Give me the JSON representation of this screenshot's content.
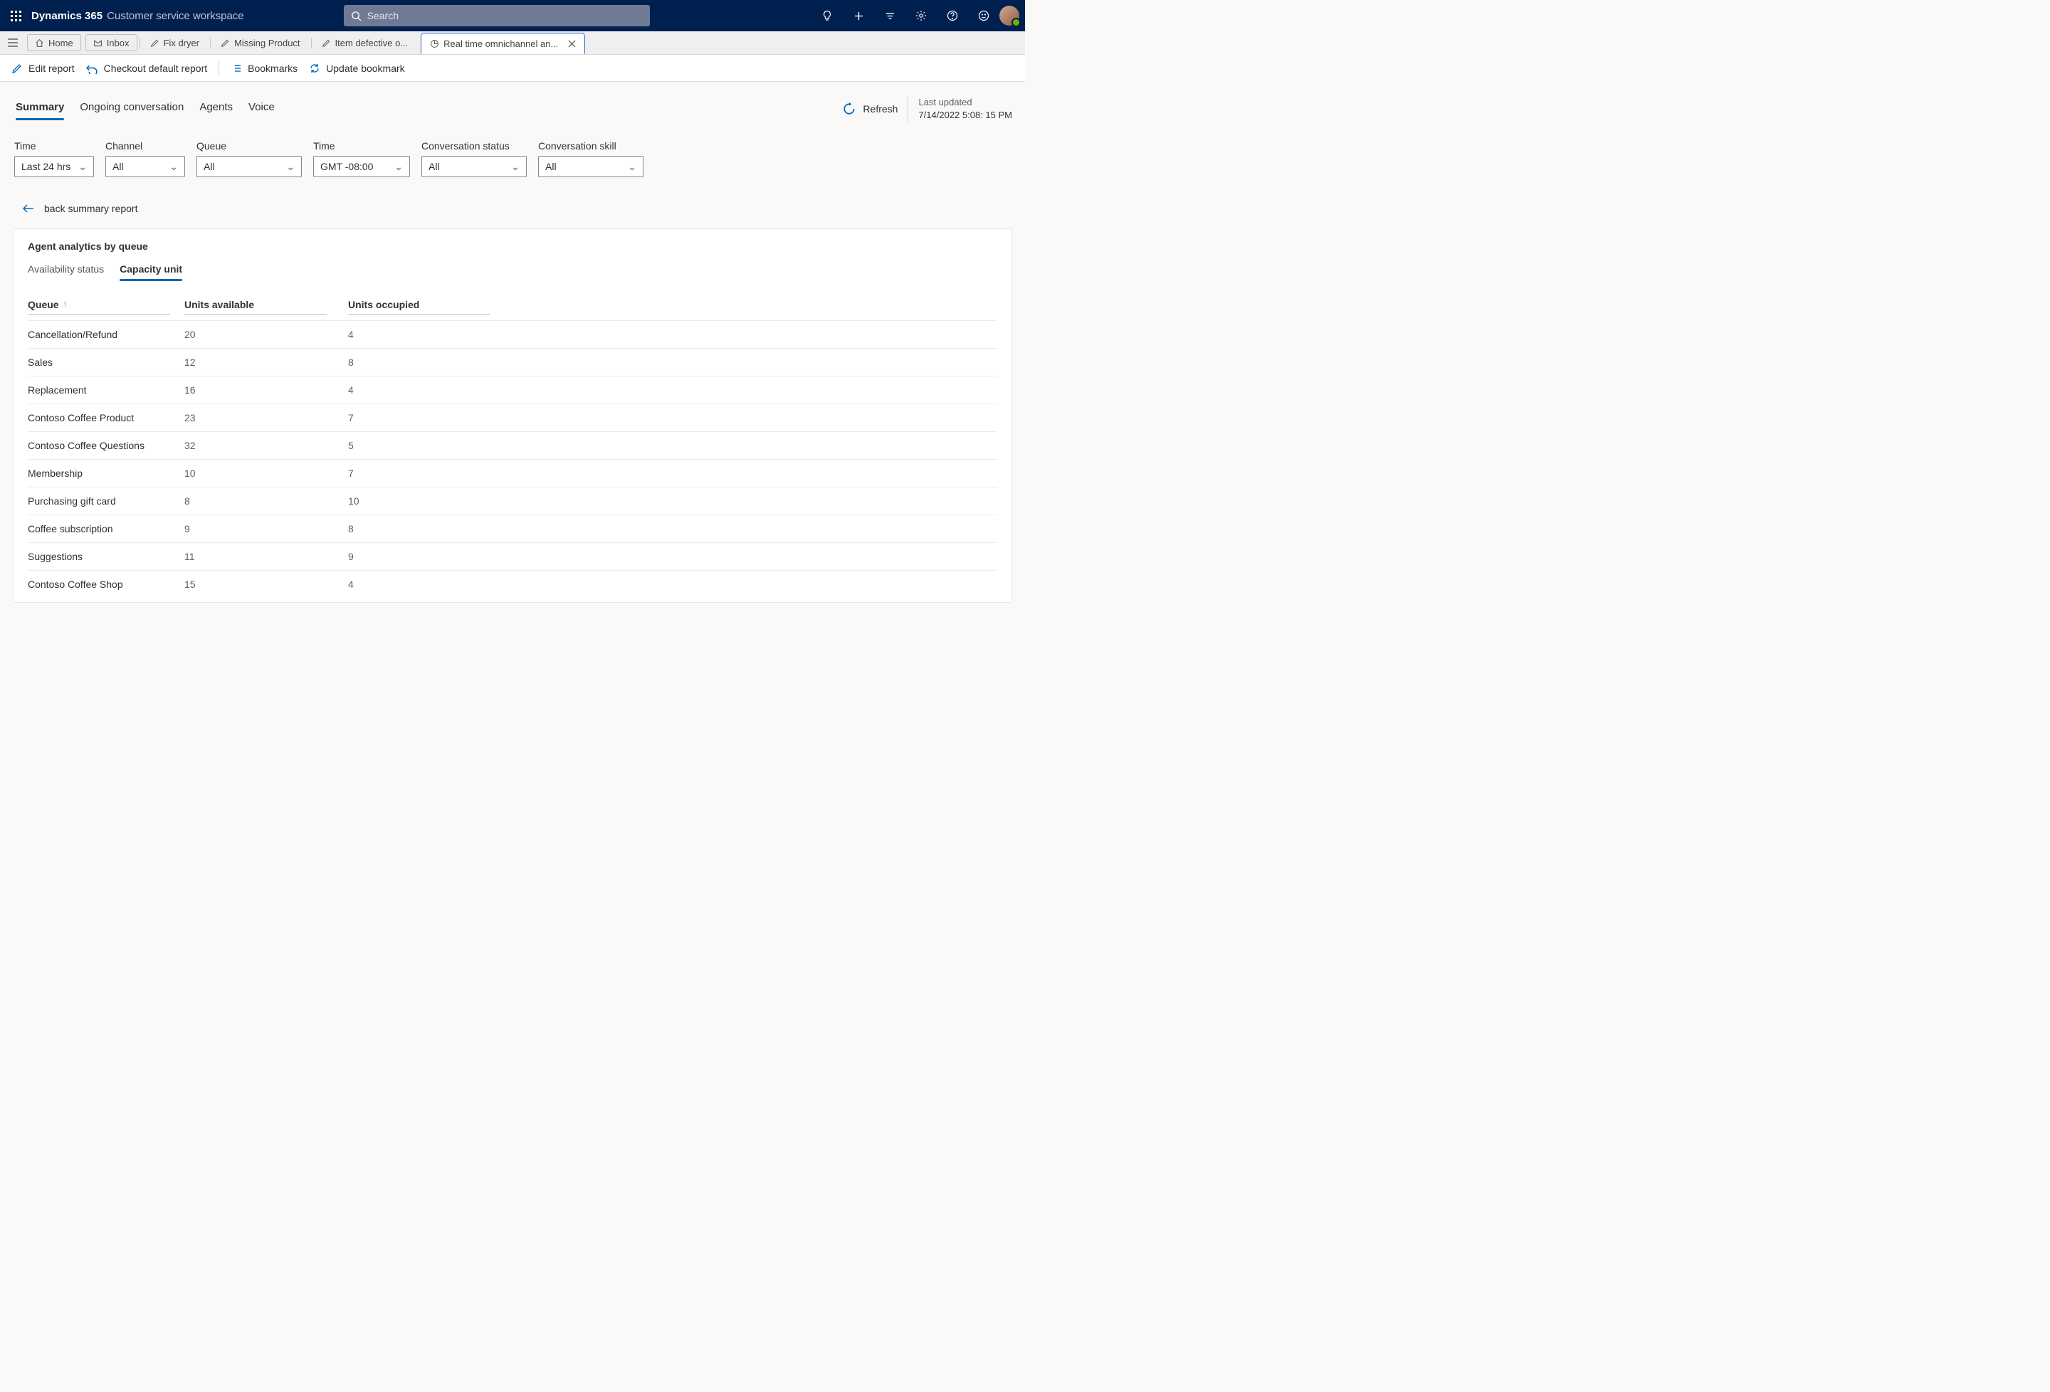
{
  "header": {
    "brand": "Dynamics 365",
    "workspace": "Customer service workspace",
    "search_placeholder": "Search"
  },
  "tabstrip": {
    "home": "Home",
    "inbox": "Inbox",
    "docs": [
      {
        "label": "Fix dryer"
      },
      {
        "label": "Missing Product"
      },
      {
        "label": "Item defective o..."
      },
      {
        "label": "Real time omnichannel an...",
        "active": true
      }
    ]
  },
  "commands": {
    "edit": "Edit report",
    "checkout": "Checkout default report",
    "bookmarks": "Bookmarks",
    "update": "Update bookmark"
  },
  "viewtabs": [
    "Summary",
    "Ongoing conversation",
    "Agents",
    "Voice"
  ],
  "refresh_label": "Refresh",
  "last_updated_label": "Last updated",
  "last_updated_value": "7/14/2022 5:08: 15 PM",
  "filters": {
    "time": {
      "label": "Time",
      "value": "Last 24 hrs"
    },
    "channel": {
      "label": "Channel",
      "value": "All"
    },
    "queue": {
      "label": "Queue",
      "value": "All"
    },
    "tz": {
      "label": "Time",
      "value": "GMT -08:00"
    },
    "status": {
      "label": "Conversation status",
      "value": "All"
    },
    "skill": {
      "label": "Conversation skill",
      "value": "All"
    }
  },
  "back_label": "back summary report",
  "card": {
    "title": "Agent analytics by queue",
    "subtabs": {
      "availability": "Availability status",
      "capacity": "Capacity unit"
    },
    "columns": {
      "queue": "Queue",
      "available": "Units available",
      "occupied": "Units occupied"
    },
    "rows": [
      {
        "queue": "Cancellation/Refund",
        "available": "20",
        "occupied": "4"
      },
      {
        "queue": "Sales",
        "available": "12",
        "occupied": "8"
      },
      {
        "queue": "Replacement",
        "available": "16",
        "occupied": "4"
      },
      {
        "queue": "Contoso Coffee Product",
        "available": "23",
        "occupied": "7"
      },
      {
        "queue": "Contoso Coffee Questions",
        "available": "32",
        "occupied": "5"
      },
      {
        "queue": "Membership",
        "available": "10",
        "occupied": "7"
      },
      {
        "queue": "Purchasing gift card",
        "available": "8",
        "occupied": "10"
      },
      {
        "queue": "Coffee subscription",
        "available": "9",
        "occupied": "8"
      },
      {
        "queue": "Suggestions",
        "available": "11",
        "occupied": "9"
      },
      {
        "queue": "Contoso Coffee Shop",
        "available": "15",
        "occupied": "4"
      }
    ]
  }
}
